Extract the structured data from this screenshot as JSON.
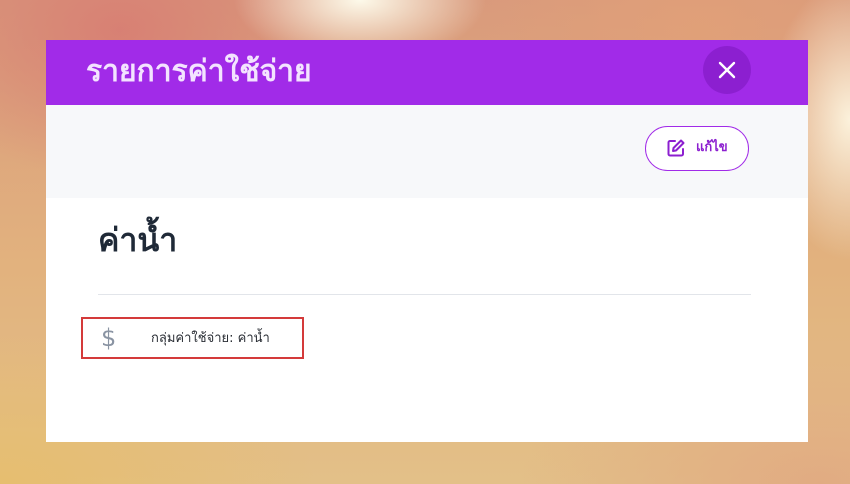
{
  "modal": {
    "title": "รายการค่าใช้จ่าย",
    "close_icon": "close-icon"
  },
  "toolbar": {
    "edit_label": "แก้ไข",
    "edit_icon": "edit-icon"
  },
  "item": {
    "title": "ค่าน้ำ",
    "expense_group_icon": "dollar-icon",
    "expense_group_text": "กลุ่มค่าใช้จ่าย: ค่าน้ำ"
  },
  "colors": {
    "accent": "#a12be8",
    "accent_dark": "#8c1fd0",
    "highlight_border": "#d43a3a",
    "toolbar_bg": "#f7f8fa",
    "title_text": "#1f2937"
  }
}
